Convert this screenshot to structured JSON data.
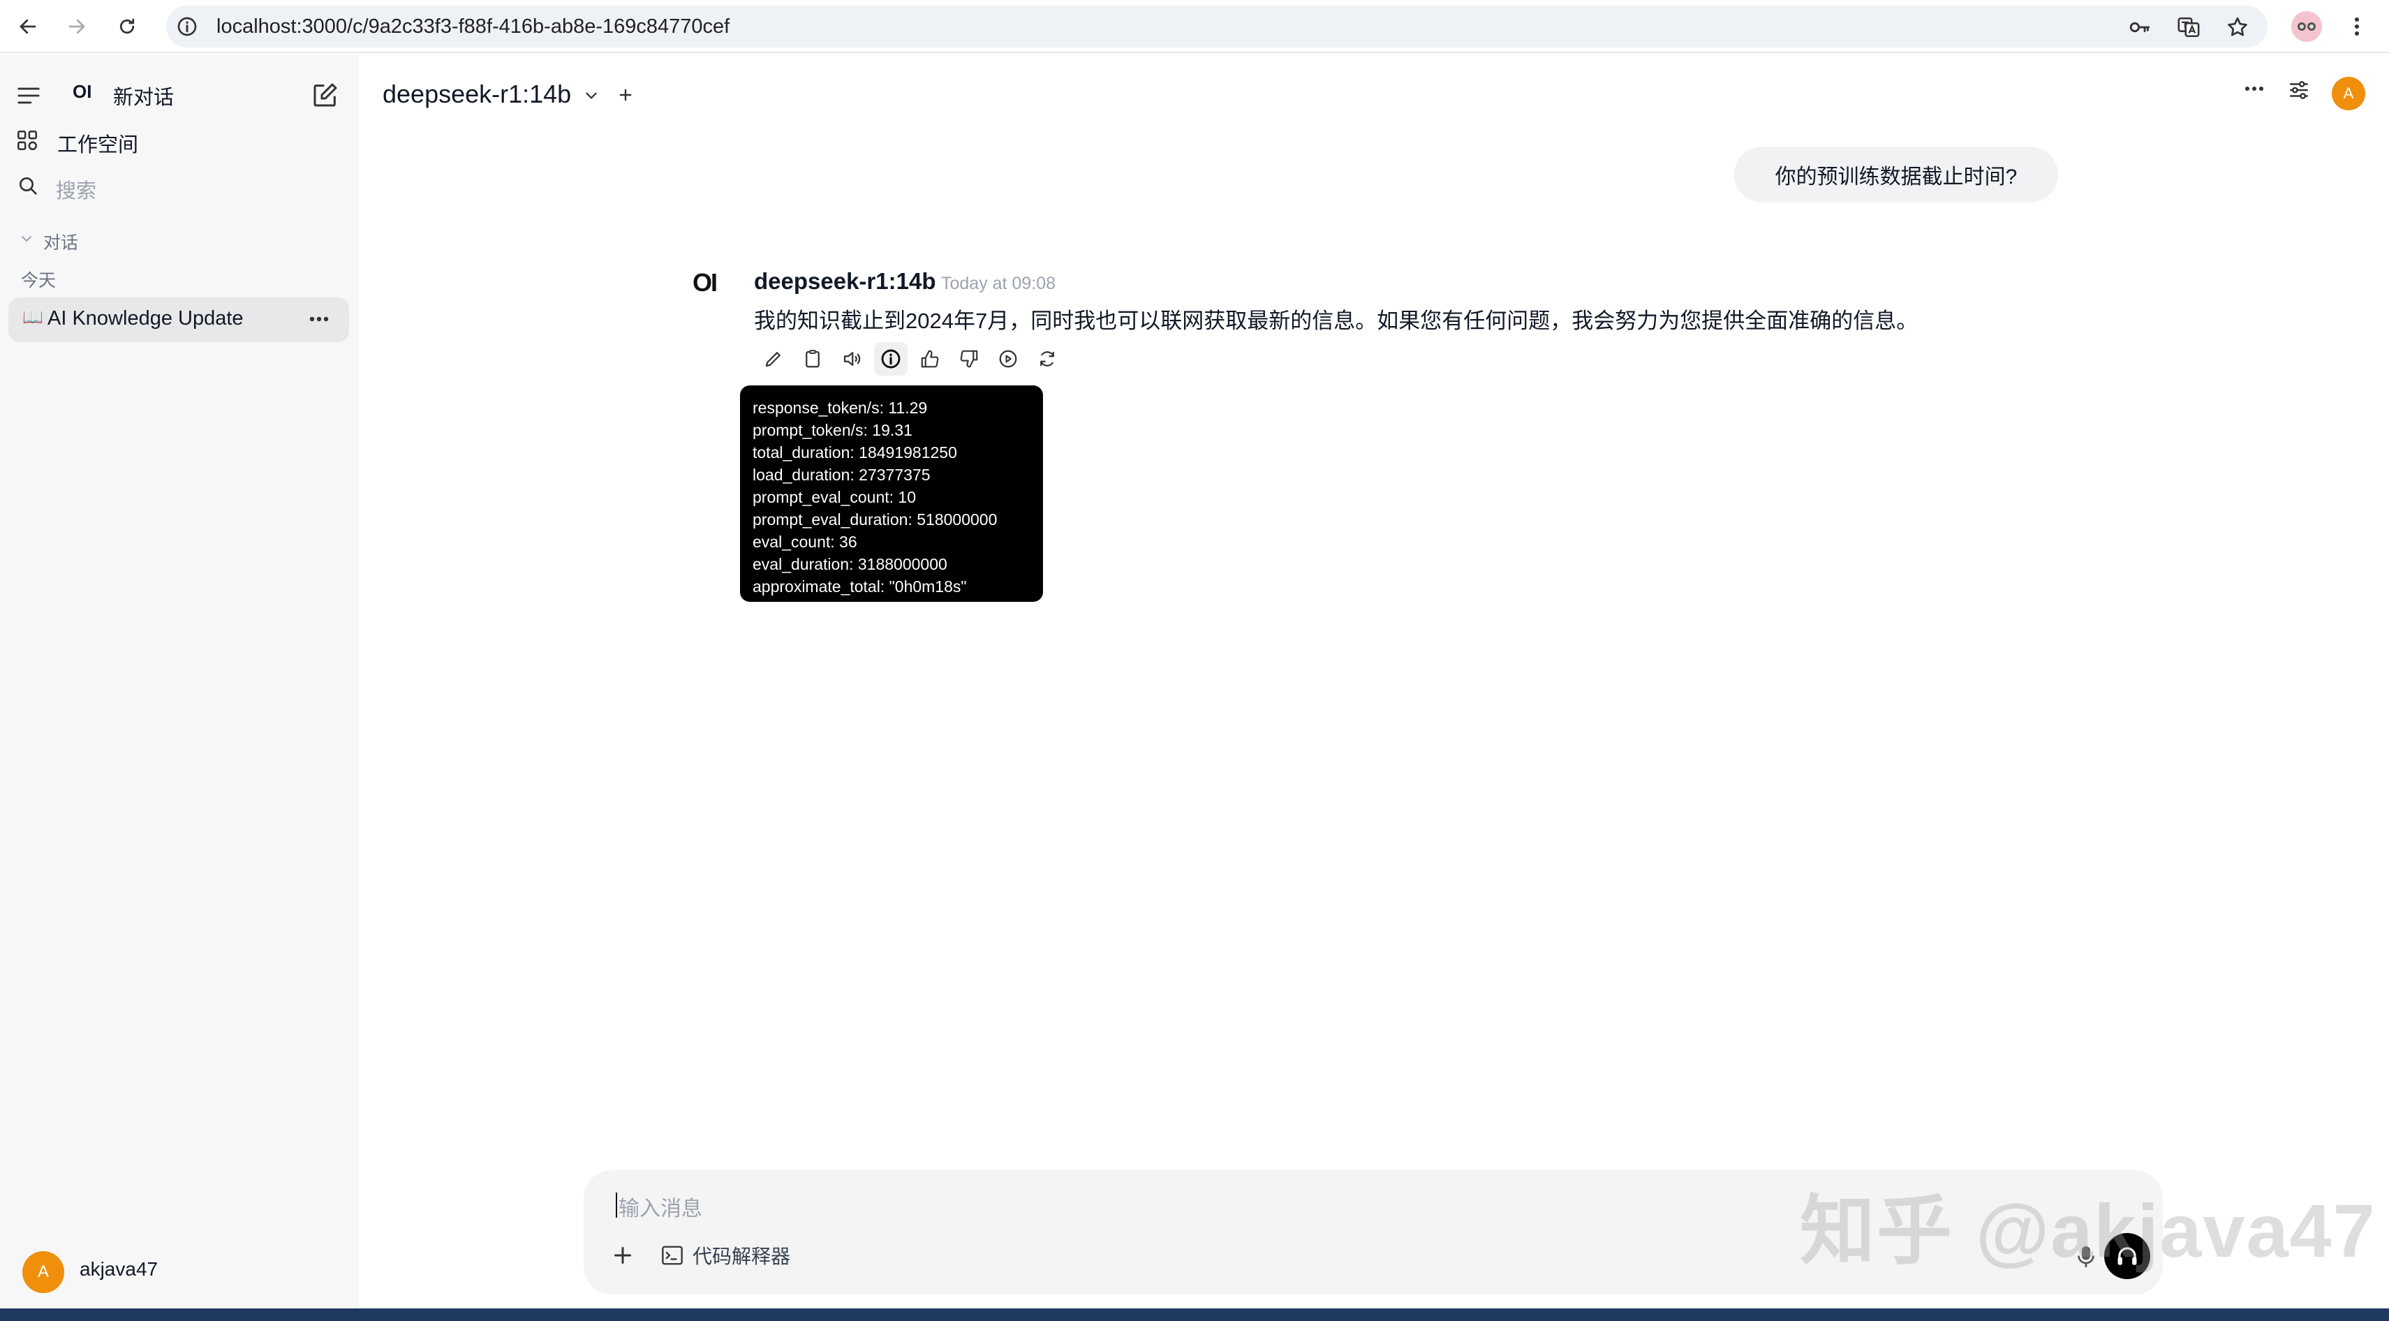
{
  "browser": {
    "url": "localhost:3000/c/9a2c33f3-f88f-416b-ab8e-169c84770cef",
    "icons": [
      "back-icon",
      "forward-icon",
      "reload-icon",
      "site-info-icon",
      "key-icon",
      "translate-icon",
      "star-icon",
      "profile-icon",
      "menu-icon"
    ]
  },
  "sidebar": {
    "logo": "OI",
    "new_chat": "新对话",
    "workspace": "工作空间",
    "search_placeholder": "搜索",
    "section": "对话",
    "group_today": "今天",
    "chat_item": {
      "emoji": "📖",
      "title": "AI Knowledge Update"
    },
    "user": {
      "initial": "A",
      "name": "akjava47"
    }
  },
  "header": {
    "model": "deepseek-r1:14b",
    "avatar_initial": "A"
  },
  "chat": {
    "user_message": "你的预训练数据截止时间?",
    "assistant": {
      "logo": "OI",
      "name": "deepseek-r1:14b",
      "time": "Today at 09:08",
      "message": "我的知识截止到2024年7月，同时我也可以联网获取最新的信息。如果您有任何问题，我会努力为您提供全面准确的信息。"
    },
    "info_tooltip": [
      "response_token/s: 11.29",
      "prompt_token/s: 19.31",
      "total_duration: 18491981250",
      "load_duration: 27377375",
      "prompt_eval_count: 10",
      "prompt_eval_duration: 518000000",
      "eval_count: 36",
      "eval_duration: 3188000000",
      "approximate_total: \"0h0m18s\""
    ]
  },
  "input": {
    "placeholder": "输入消息",
    "code_interpreter": "代码解释器"
  },
  "watermark": "知乎 @akjava47",
  "colors": {
    "accent": "#ef8f0b",
    "sidebar_bg": "#f7f7f8",
    "tooltip_bg": "#000000"
  }
}
